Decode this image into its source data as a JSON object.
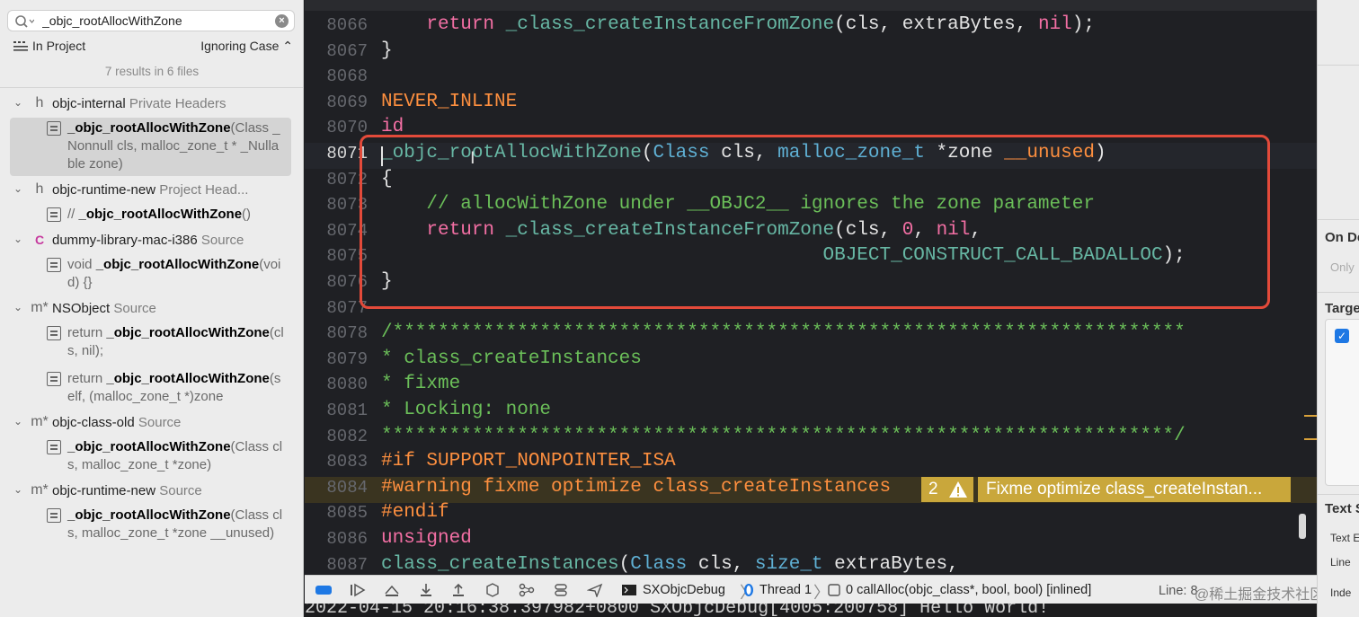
{
  "search": {
    "query": "_objc_rootAllocWithZone",
    "scope": "In Project",
    "case_option": "Ignoring Case",
    "results_summary": "7 results in 6 files"
  },
  "files": [
    {
      "name": "objc-internal",
      "kind": "Private Headers",
      "icon": "h",
      "matches": [
        {
          "before": "",
          "hit": "_objc_rootAllocWithZone",
          "after": "(Class _Nonnull cls, malloc_zone_t * _Nullable zone)",
          "selected": true
        }
      ]
    },
    {
      "name": "objc-runtime-new",
      "kind": "Project Head...",
      "icon": "h",
      "matches": [
        {
          "before": "// ",
          "hit": "_objc_rootAllocWithZone",
          "after": "()",
          "selected": false
        }
      ]
    },
    {
      "name": "dummy-library-mac-i386",
      "kind": "Source",
      "icon": "C",
      "matches": [
        {
          "before": "void ",
          "hit": "_objc_rootAllocWithZone",
          "after": "(void) {}",
          "selected": false
        }
      ]
    },
    {
      "name": "NSObject",
      "kind": "Source",
      "icon": "m*",
      "matches": [
        {
          "before": "return ",
          "hit": "_objc_rootAllocWithZone",
          "after": "(cls, nil);",
          "selected": false
        },
        {
          "before": "return ",
          "hit": "_objc_rootAllocWithZone",
          "after": "(self, (malloc_zone_t *)zone",
          "selected": false
        }
      ]
    },
    {
      "name": "objc-class-old",
      "kind": "Source",
      "icon": "m*",
      "matches": [
        {
          "before": "",
          "hit": "_objc_rootAllocWithZone",
          "after": "(Class cls, malloc_zone_t *zone)",
          "selected": false
        }
      ]
    },
    {
      "name": "objc-runtime-new",
      "kind": "Source",
      "icon": "m*",
      "matches": [
        {
          "before": "",
          "hit": "_objc_rootAllocWithZone",
          "after": "(Class cls, malloc_zone_t *zone __unused)",
          "selected": false
        }
      ]
    }
  ],
  "editor": {
    "current_line": "8071",
    "lines": [
      {
        "n": "8066",
        "segs": [
          [
            "",
            "    "
          ],
          [
            "kw",
            "return"
          ],
          [
            "",
            " "
          ],
          [
            "fn",
            "_class_createInstanceFromZone"
          ],
          [
            "",
            "(cls, extraBytes, "
          ],
          [
            "kw",
            "nil"
          ],
          [
            "",
            ");"
          ]
        ]
      },
      {
        "n": "8067",
        "segs": [
          [
            "",
            "}"
          ]
        ]
      },
      {
        "n": "8068",
        "segs": []
      },
      {
        "n": "8069",
        "segs": [
          [
            "pp",
            "NEVER_INLINE"
          ]
        ]
      },
      {
        "n": "8070",
        "segs": [
          [
            "kw",
            "id"
          ]
        ]
      },
      {
        "n": "8071",
        "segs": [
          [
            "fn",
            "_objc_rootAllocWithZone"
          ],
          [
            "",
            "("
          ],
          [
            "ty",
            "Class"
          ],
          [
            "",
            " cls, "
          ],
          [
            "ty",
            "malloc_zone_t"
          ],
          [
            "",
            " *zone "
          ],
          [
            "pp",
            "__unused"
          ],
          [
            "",
            ")"
          ]
        ]
      },
      {
        "n": "8072",
        "segs": [
          [
            "",
            "{"
          ]
        ]
      },
      {
        "n": "8073",
        "segs": [
          [
            "",
            "    "
          ],
          [
            "cm",
            "// allocWithZone under __OBJC2__ ignores the zone parameter"
          ]
        ]
      },
      {
        "n": "8074",
        "segs": [
          [
            "",
            "    "
          ],
          [
            "kw",
            "return"
          ],
          [
            "",
            " "
          ],
          [
            "fn",
            "_class_createInstanceFromZone"
          ],
          [
            "",
            "(cls, "
          ],
          [
            "kw",
            "0"
          ],
          [
            "",
            ", "
          ],
          [
            "kw",
            "nil"
          ],
          [
            "",
            ","
          ]
        ]
      },
      {
        "n": "8075",
        "segs": [
          [
            "",
            "                                       "
          ],
          [
            "fn",
            "OBJECT_CONSTRUCT_CALL_BADALLOC"
          ],
          [
            "",
            ");"
          ]
        ]
      },
      {
        "n": "8076",
        "segs": [
          [
            "",
            "}"
          ]
        ]
      },
      {
        "n": "8077",
        "segs": []
      },
      {
        "n": "8078",
        "segs": [
          [
            "cm",
            "/**********************************************************************"
          ]
        ]
      },
      {
        "n": "8079",
        "segs": [
          [
            "cm",
            "* class_createInstances"
          ]
        ]
      },
      {
        "n": "8080",
        "segs": [
          [
            "cm",
            "* fixme"
          ]
        ]
      },
      {
        "n": "8081",
        "segs": [
          [
            "cm",
            "* Locking: none"
          ]
        ]
      },
      {
        "n": "8082",
        "segs": [
          [
            "cm",
            "**********************************************************************/"
          ]
        ]
      },
      {
        "n": "8083",
        "segs": [
          [
            "pp",
            "#if SUPPORT_NONPOINTER_ISA"
          ]
        ]
      },
      {
        "n": "8084",
        "segs": [
          [
            "pp",
            "#warning fixme optimize class_createInstances"
          ]
        ]
      },
      {
        "n": "8085",
        "segs": [
          [
            "pp",
            "#endif"
          ]
        ]
      },
      {
        "n": "8086",
        "segs": [
          [
            "kw",
            "unsigned"
          ]
        ]
      },
      {
        "n": "8087",
        "segs": [
          [
            "fn",
            "class_createInstances"
          ],
          [
            "",
            "("
          ],
          [
            "ty",
            "Class"
          ],
          [
            "",
            " cls, "
          ],
          [
            "ty",
            "size_t"
          ],
          [
            "",
            " extraBytes,"
          ]
        ]
      }
    ],
    "warning_count": "2",
    "warning_message": "Fixme optimize class_createInstan..."
  },
  "debug_bar": {
    "scheme": "SXObjcDebug",
    "thread": "Thread 1",
    "frame": "0 callAlloc(objc_class*, bool, bool) [inlined]",
    "line_label": "Line: 8",
    "watermark": "@稀土掘金技术社区"
  },
  "console": {
    "output": "2022-04-15 20:16:38.397982+0800 SXObjcDebug[4005:200758] Hello World!"
  },
  "inspector": {
    "on_demand": "On De",
    "only": "Only",
    "target": "Targe",
    "text_settings": "Text S",
    "text_encoding": "Text E",
    "line_endings": "Line",
    "indent": "Inde"
  },
  "colors": {
    "keyword": "#f36fa4",
    "function": "#67b7a4",
    "type": "#5fb0d4",
    "preprocessor": "#fd8f3f",
    "comment": "#6bbf59",
    "warning_bg": "#c9a73b",
    "highlight_box": "#e34a3a"
  }
}
